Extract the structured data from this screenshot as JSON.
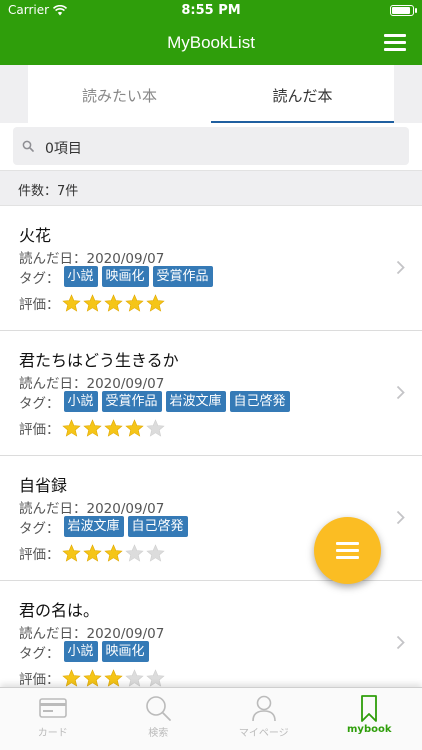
{
  "status_bar": {
    "carrier": "Carrier",
    "time": "8:55 PM"
  },
  "nav": {
    "title": "MyBookList"
  },
  "tabs": [
    {
      "label": "読みたい本",
      "active": false
    },
    {
      "label": "読んだ本",
      "active": true
    }
  ],
  "search": {
    "value": "0項目"
  },
  "count": {
    "text": "件数：7件"
  },
  "labels": {
    "read_date": "読んだ日：",
    "tags": "タグ：",
    "rating": "評価："
  },
  "books": [
    {
      "title": "火花",
      "date": "2020/09/07",
      "tags": [
        "小説",
        "映画化",
        "受賞作品"
      ],
      "rating": 5
    },
    {
      "title": "君たちはどう生きるか",
      "date": "2020/09/07",
      "tags": [
        "小説",
        "受賞作品",
        "岩波文庫",
        "自己啓発"
      ],
      "rating": 4
    },
    {
      "title": "自省録",
      "date": "2020/09/07",
      "tags": [
        "岩波文庫",
        "自己啓発"
      ],
      "rating": 3
    },
    {
      "title": "君の名は。",
      "date": "2020/09/07",
      "tags": [
        "小説",
        "映画化"
      ],
      "rating": 3
    }
  ],
  "rating_max": 5,
  "colors": {
    "primary_green": "#2f9e0b",
    "tag_blue": "#357ab6",
    "star_yellow": "#f5c518",
    "fab_yellow": "#fbbd23"
  },
  "tabbar": [
    {
      "label": "カード",
      "icon": "card-icon",
      "active": false
    },
    {
      "label": "検索",
      "icon": "search-icon",
      "active": false
    },
    {
      "label": "マイページ",
      "icon": "user-icon",
      "active": false
    },
    {
      "label": "mybook",
      "icon": "bookmark-icon",
      "active": true
    }
  ]
}
